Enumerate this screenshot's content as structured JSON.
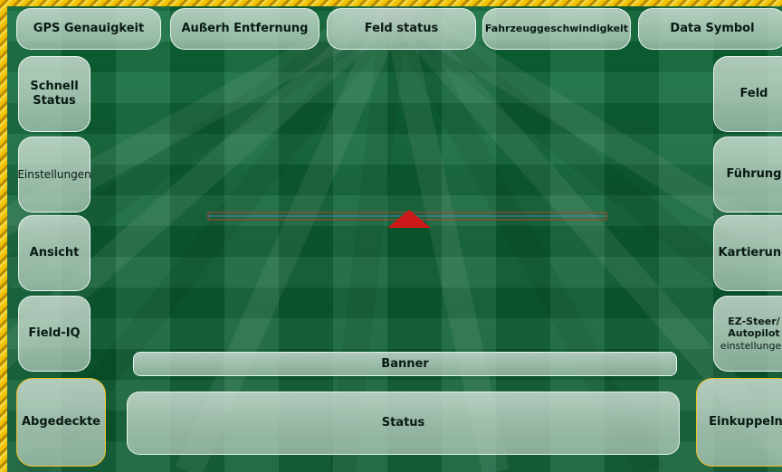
{
  "top_bar": {
    "gps": "GPS Genauigkeit",
    "ausserh": "Außerh Entfernung",
    "feld_status": "Feld status",
    "fahrzeug": "Fahrzeuggeschwindigkeit",
    "data_symbol": "Data Symbol"
  },
  "left_bar": {
    "schnell_1": "Schnell",
    "schnell_2": "Status",
    "einstellungen": "Einstellungen",
    "ansicht": "Ansicht",
    "field_iq": "Field-IQ",
    "abgedeckte": "Abgedeckte"
  },
  "right_bar": {
    "feld": "Feld",
    "fuhrung": "Führung",
    "kartierung": "Kartierung",
    "ez_1": "EZ-Steer/",
    "ez_2": "Autopilot",
    "ez_3": "einstellungen",
    "einkuppeln": "Einkuppeln"
  },
  "bottom": {
    "banner": "Banner",
    "status": "Status"
  },
  "colors": {
    "field": "#0d6235",
    "frame": "#f2c200",
    "vehicle": "#cc1a1a",
    "boom": "#8a3a2a"
  },
  "icons": {
    "vehicle": "red-triangle-vehicle-icon"
  }
}
